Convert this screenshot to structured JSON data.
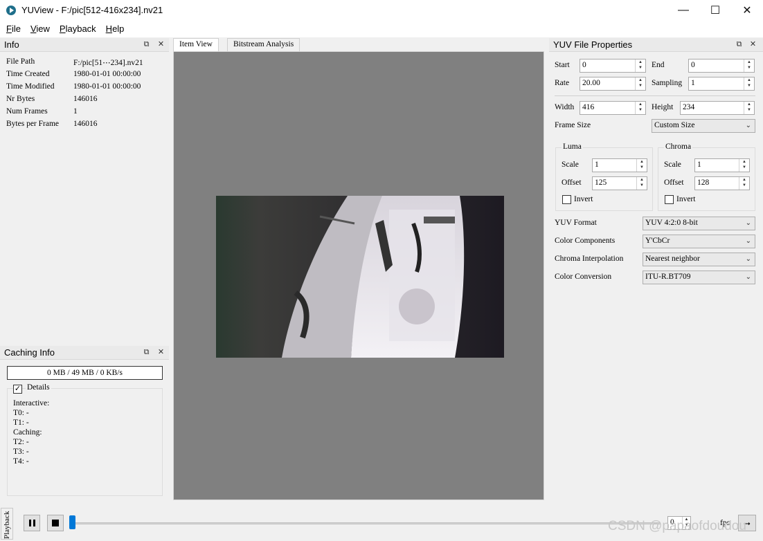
{
  "window": {
    "title": "YUView - F:/pic[512-416x234].nv21",
    "minimize": "—",
    "maximize": "☐",
    "close": "✕"
  },
  "menu": [
    {
      "label_u": "F",
      "label_rest": "ile"
    },
    {
      "label_u": "V",
      "label_rest": "iew"
    },
    {
      "label_u": "P",
      "label_rest": "layback"
    },
    {
      "label_u": "H",
      "label_rest": "elp"
    }
  ],
  "info_panel": {
    "title": "Info",
    "rows": [
      {
        "key": "File Path",
        "value": "F:/pic[51⋯234].nv21"
      },
      {
        "key": "Time Created",
        "value": "1980-01-01 00:00:00"
      },
      {
        "key": "Time Modified",
        "value": "1980-01-01 00:00:00"
      },
      {
        "key": "Nr Bytes",
        "value": "146016"
      },
      {
        "key": "Num Frames",
        "value": "1"
      },
      {
        "key": "Bytes per Frame",
        "value": "146016"
      }
    ]
  },
  "caching_panel": {
    "title": "Caching Info",
    "rate": "0 MB / 49 MB / 0 KB/s",
    "details_label": "Details",
    "details_checked": true,
    "lines": [
      "Interactive:",
      "T0: -",
      "T1: -",
      "Caching:",
      "T2: -",
      "T3: -",
      "T4: -"
    ]
  },
  "tabs": [
    {
      "label": "Item View",
      "active": true
    },
    {
      "label": "Bitstream Analysis",
      "active": false
    }
  ],
  "properties": {
    "title": "YUV File Properties",
    "start_label": "Start",
    "start": "0",
    "end_label": "End",
    "end": "0",
    "rate_label": "Rate",
    "rate": "20.00",
    "sampling_label": "Sampling",
    "sampling": "1",
    "width_label": "Width",
    "width": "416",
    "height_label": "Height",
    "height": "234",
    "frame_size_label": "Frame Size",
    "frame_size": "Custom Size",
    "luma": {
      "title": "Luma",
      "scale_label": "Scale",
      "scale": "1",
      "offset_label": "Offset",
      "offset": "125",
      "invert_label": "Invert"
    },
    "chroma": {
      "title": "Chroma",
      "scale_label": "Scale",
      "scale": "1",
      "offset_label": "Offset",
      "offset": "128",
      "invert_label": "Invert"
    },
    "yuv_format_label": "YUV Format",
    "yuv_format": "YUV 4:2:0 8-bit",
    "color_components_label": "Color Components",
    "color_components": "Y'CbCr",
    "chroma_interp_label": "Chroma Interpolation",
    "chroma_interp": "Nearest neighbor",
    "color_conversion_label": "Color Conversion",
    "color_conversion": "ITU-R.BT709"
  },
  "playback": {
    "side_label": "Playback",
    "frame": "0",
    "fps_label": "fps",
    "watermark": "CSDN @papaofdoudou"
  },
  "colors": {
    "view_bg": "#808080",
    "slider_handle": "#0078d7"
  }
}
